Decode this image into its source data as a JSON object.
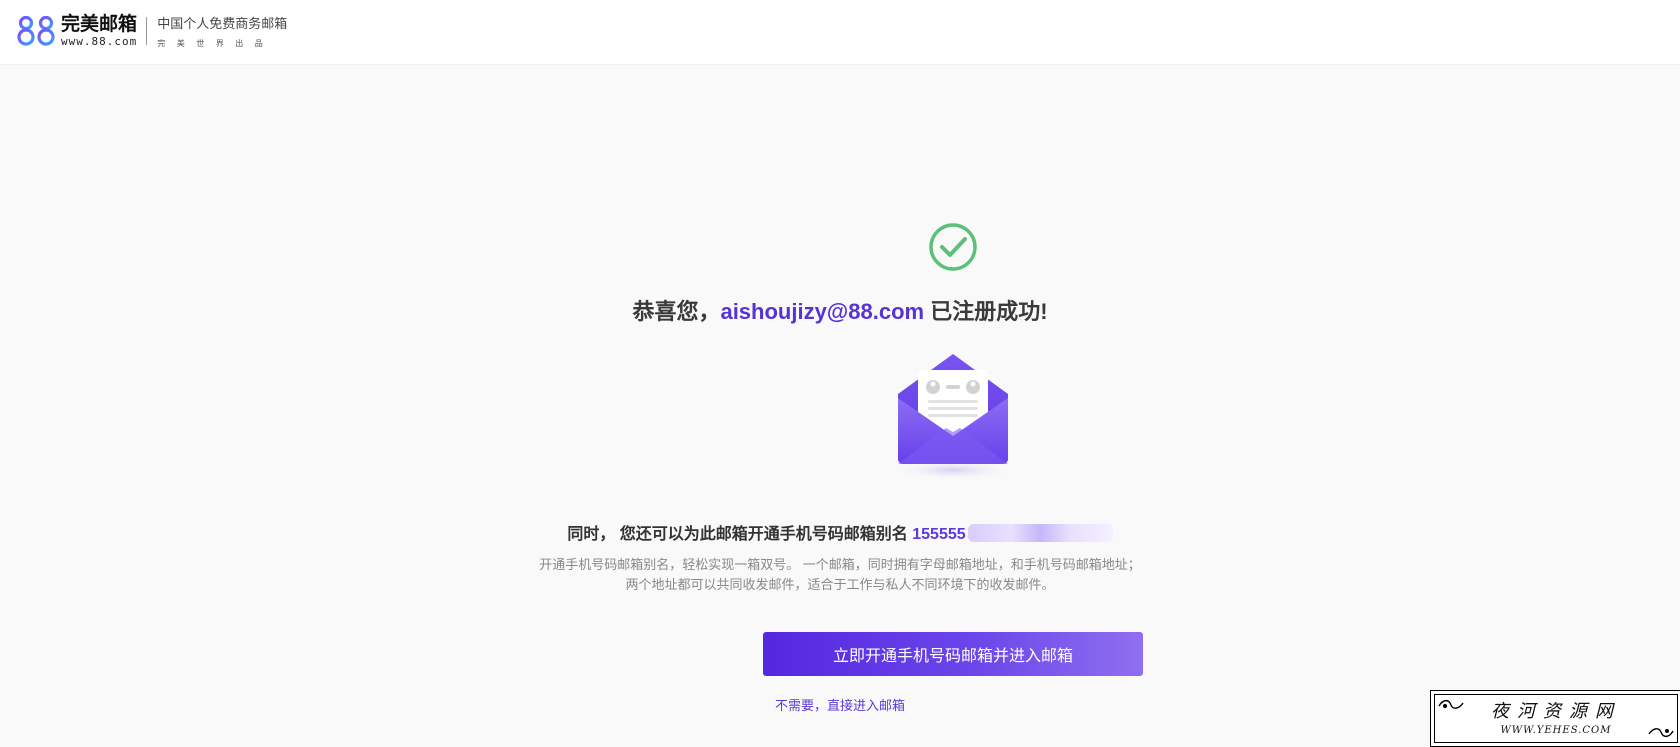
{
  "header": {
    "logo_name": "完美邮箱",
    "logo_url": "www.88.com",
    "tagline": "中国个人免费商务邮箱",
    "tagline_sub": "完美世界出品"
  },
  "success": {
    "prefix": "恭喜您，",
    "email": "aishoujizy@88.com",
    "suffix": " 已注册成功!"
  },
  "alias": {
    "text": "同时， 您还可以为此邮箱开通手机号码邮箱别名 ",
    "number_visible": "155555"
  },
  "description": {
    "line1": "开通手机号码邮箱别名，轻松实现一箱双号。 一个邮箱，同时拥有字母邮箱地址，和手机号码邮箱地址；",
    "line2": "两个地址都可以共同收发邮件，适合于工作与私人不同环境下的收发邮件。"
  },
  "actions": {
    "primary_label": "立即开通手机号码邮箱并进入邮箱",
    "skip_label": "不需要，直接进入邮箱"
  },
  "watermark": {
    "title": "夜河资源网",
    "url": "WWW.YEHES.COM"
  },
  "colors": {
    "accent": "#5533d6",
    "check_green": "#5cc07a",
    "button_gradient_start": "#5427e0",
    "button_gradient_end": "#8f6ff0"
  }
}
